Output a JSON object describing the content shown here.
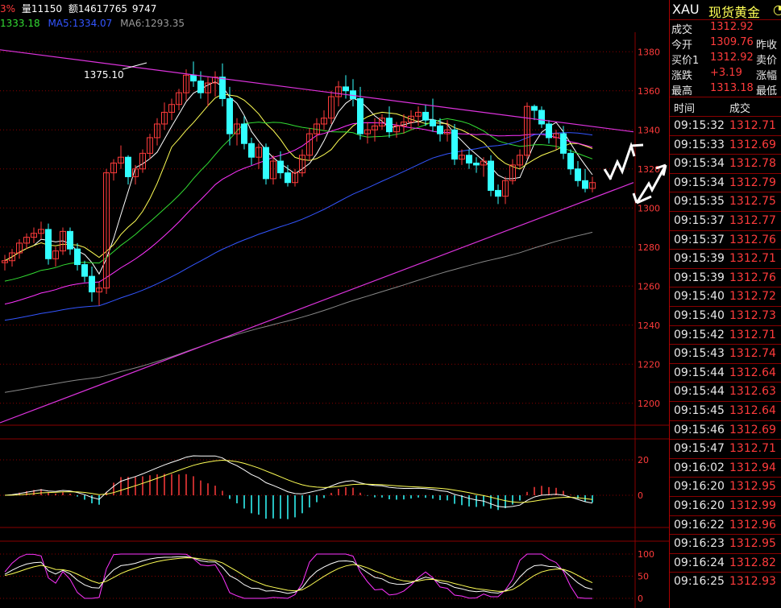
{
  "info_bar": {
    "left_fragment": "3%",
    "volume": "量11150",
    "amount": "额14617765",
    "extra": "9747"
  },
  "ma_bar": {
    "ma1": "1333.18",
    "ma5": "MA5:1334.07",
    "ma6": "MA6:1293.35"
  },
  "annotation": "1375.10",
  "price_axis": [
    "1380",
    "1360",
    "1340",
    "1320",
    "1300",
    "1280",
    "1260",
    "1240",
    "1220",
    "1200"
  ],
  "macd_axis": [
    "20",
    "0"
  ],
  "kdj_axis": [
    "100",
    "50",
    "0"
  ],
  "colors": {
    "up": "#ff3b3b",
    "down": "#33ffff",
    "ma_white": "#ffffff",
    "ma_yellow": "#ffff55",
    "ma_green": "#33dd33",
    "ma_magenta": "#ff33ff",
    "ma_blue": "#3355ff",
    "ma_gray": "#888888",
    "trendline": "#dd33dd",
    "grid": "#8a0000"
  },
  "quote_panel": {
    "symbol": "XAU",
    "name": "现货黄金",
    "rows": [
      {
        "label": "成交",
        "value": "1312.92",
        "label2": ""
      },
      {
        "label": "今开",
        "value": "1309.76",
        "label2": "昨收"
      },
      {
        "label": "买价1",
        "value": "1312.92",
        "label2": "卖价"
      },
      {
        "label": "涨跌",
        "value": "+3.19",
        "label2": "涨幅"
      },
      {
        "label": "最高",
        "value": "1313.18",
        "label2": "最低"
      }
    ],
    "ticks_header": {
      "time": "时间",
      "price": "成交"
    },
    "ticks": [
      {
        "time": "09:15:32",
        "price": "1312.71"
      },
      {
        "time": "09:15:33",
        "price": "1312.69"
      },
      {
        "time": "09:15:34",
        "price": "1312.78"
      },
      {
        "time": "09:15:34",
        "price": "1312.79"
      },
      {
        "time": "09:15:35",
        "price": "1312.75"
      },
      {
        "time": "09:15:37",
        "price": "1312.77"
      },
      {
        "time": "09:15:37",
        "price": "1312.76"
      },
      {
        "time": "09:15:39",
        "price": "1312.71"
      },
      {
        "time": "09:15:39",
        "price": "1312.76"
      },
      {
        "time": "09:15:40",
        "price": "1312.72"
      },
      {
        "time": "09:15:40",
        "price": "1312.73"
      },
      {
        "time": "09:15:42",
        "price": "1312.71"
      },
      {
        "time": "09:15:43",
        "price": "1312.74"
      },
      {
        "time": "09:15:44",
        "price": "1312.64"
      },
      {
        "time": "09:15:44",
        "price": "1312.63"
      },
      {
        "time": "09:15:45",
        "price": "1312.64"
      },
      {
        "time": "09:15:46",
        "price": "1312.69"
      },
      {
        "time": "09:15:47",
        "price": "1312.71"
      },
      {
        "time": "09:16:02",
        "price": "1312.94"
      },
      {
        "time": "09:16:20",
        "price": "1312.95"
      },
      {
        "time": "09:16:20",
        "price": "1312.99"
      },
      {
        "time": "09:16:22",
        "price": "1312.96"
      },
      {
        "time": "09:16:23",
        "price": "1312.95"
      },
      {
        "time": "09:16:24",
        "price": "1312.82"
      },
      {
        "time": "09:16:25",
        "price": "1312.93"
      }
    ]
  },
  "chart_data": {
    "type": "candlestick",
    "ylim": [
      1190,
      1390
    ],
    "candles": [
      [
        1272,
        1276,
        1268,
        1273
      ],
      [
        1273,
        1279,
        1270,
        1277
      ],
      [
        1277,
        1284,
        1274,
        1282
      ],
      [
        1282,
        1287,
        1279,
        1285
      ],
      [
        1285,
        1290,
        1282,
        1287
      ],
      [
        1287,
        1293,
        1284,
        1289
      ],
      [
        1289,
        1292,
        1271,
        1274
      ],
      [
        1274,
        1280,
        1270,
        1278
      ],
      [
        1278,
        1290,
        1276,
        1288
      ],
      [
        1288,
        1290,
        1276,
        1279
      ],
      [
        1279,
        1282,
        1268,
        1271
      ],
      [
        1271,
        1273,
        1262,
        1265
      ],
      [
        1265,
        1270,
        1252,
        1257
      ],
      [
        1257,
        1262,
        1250,
        1259
      ],
      [
        1259,
        1320,
        1256,
        1318
      ],
      [
        1318,
        1325,
        1314,
        1323
      ],
      [
        1323,
        1332,
        1320,
        1326
      ],
      [
        1326,
        1327,
        1312,
        1316
      ],
      [
        1316,
        1322,
        1312,
        1320
      ],
      [
        1320,
        1330,
        1318,
        1328
      ],
      [
        1328,
        1338,
        1325,
        1336
      ],
      [
        1336,
        1346,
        1332,
        1343
      ],
      [
        1343,
        1354,
        1340,
        1349
      ],
      [
        1349,
        1356,
        1345,
        1353
      ],
      [
        1353,
        1361,
        1350,
        1359
      ],
      [
        1359,
        1371,
        1355,
        1368
      ],
      [
        1368,
        1375,
        1362,
        1365
      ],
      [
        1365,
        1370,
        1356,
        1359
      ],
      [
        1359,
        1367,
        1352,
        1364
      ],
      [
        1364,
        1370,
        1357,
        1367
      ],
      [
        1367,
        1374,
        1352,
        1356
      ],
      [
        1356,
        1362,
        1332,
        1338
      ],
      [
        1338,
        1346,
        1332,
        1343
      ],
      [
        1343,
        1347,
        1330,
        1333
      ],
      [
        1333,
        1336,
        1322,
        1326
      ],
      [
        1326,
        1333,
        1320,
        1331
      ],
      [
        1331,
        1333,
        1312,
        1315
      ],
      [
        1315,
        1327,
        1312,
        1324
      ],
      [
        1324,
        1329,
        1315,
        1318
      ],
      [
        1318,
        1322,
        1311,
        1313
      ],
      [
        1313,
        1320,
        1311,
        1318
      ],
      [
        1318,
        1330,
        1316,
        1327
      ],
      [
        1327,
        1341,
        1324,
        1338
      ],
      [
        1338,
        1346,
        1334,
        1343
      ],
      [
        1343,
        1350,
        1340,
        1346
      ],
      [
        1346,
        1360,
        1343,
        1357
      ],
      [
        1357,
        1365,
        1352,
        1362
      ],
      [
        1362,
        1368,
        1356,
        1360
      ],
      [
        1360,
        1366,
        1352,
        1356
      ],
      [
        1356,
        1362,
        1335,
        1338
      ],
      [
        1338,
        1344,
        1333,
        1340
      ],
      [
        1340,
        1346,
        1334,
        1342
      ],
      [
        1342,
        1348,
        1340,
        1346
      ],
      [
        1346,
        1352,
        1336,
        1339
      ],
      [
        1339,
        1344,
        1336,
        1342
      ],
      [
        1342,
        1348,
        1338,
        1344
      ],
      [
        1344,
        1350,
        1340,
        1347
      ],
      [
        1347,
        1352,
        1342,
        1349
      ],
      [
        1349,
        1353,
        1342,
        1345
      ],
      [
        1345,
        1356,
        1339,
        1342
      ],
      [
        1342,
        1346,
        1334,
        1338
      ],
      [
        1338,
        1345,
        1334,
        1340
      ],
      [
        1340,
        1343,
        1322,
        1325
      ],
      [
        1325,
        1330,
        1322,
        1327
      ],
      [
        1327,
        1330,
        1320,
        1323
      ],
      [
        1323,
        1326,
        1318,
        1322
      ],
      [
        1322,
        1326,
        1316,
        1324
      ],
      [
        1324,
        1327,
        1306,
        1309
      ],
      [
        1309,
        1312,
        1302,
        1306
      ],
      [
        1306,
        1316,
        1302,
        1314
      ],
      [
        1314,
        1325,
        1312,
        1322
      ],
      [
        1322,
        1330,
        1320,
        1327
      ],
      [
        1327,
        1354,
        1325,
        1352
      ],
      [
        1352,
        1353,
        1345,
        1350
      ],
      [
        1350,
        1352,
        1341,
        1343
      ],
      [
        1343,
        1345,
        1333,
        1336
      ],
      [
        1336,
        1340,
        1330,
        1338
      ],
      [
        1338,
        1342,
        1325,
        1328
      ],
      [
        1328,
        1330,
        1317,
        1320
      ],
      [
        1320,
        1324,
        1311,
        1314
      ],
      [
        1314,
        1320,
        1308,
        1310
      ],
      [
        1310,
        1316,
        1308,
        1313
      ]
    ]
  }
}
